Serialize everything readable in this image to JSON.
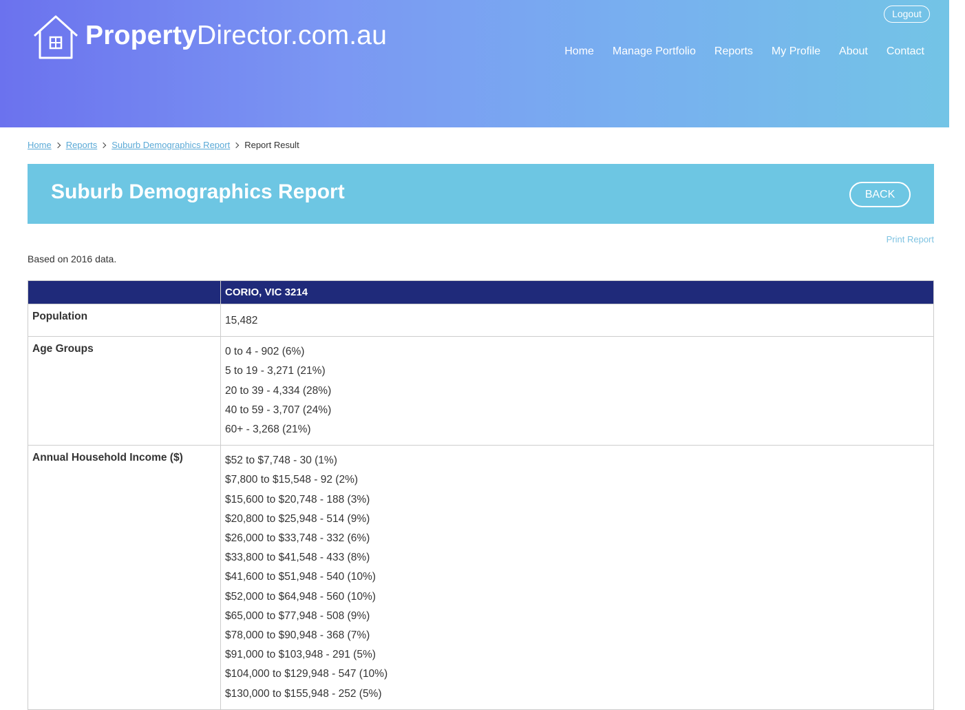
{
  "header": {
    "logo": {
      "bold": "Property",
      "light": "Director.com.au"
    },
    "logout_label": "Logout",
    "nav": [
      "Home",
      "Manage Portfolio",
      "Reports",
      "My Profile",
      "About",
      "Contact"
    ]
  },
  "breadcrumb": {
    "items": [
      "Home",
      "Reports",
      "Suburb Demographics Report"
    ],
    "current": "Report Result"
  },
  "banner": {
    "title": "Suburb Demographics Report",
    "back_label": "BACK"
  },
  "print_label": "Print Report",
  "based_on": "Based on 2016 data.",
  "table": {
    "header_col1": "",
    "header_col2": "CORIO, VIC 3214",
    "rows": [
      {
        "label": "Population",
        "values": [
          "15,482"
        ]
      },
      {
        "label": "Age Groups",
        "values": [
          "0 to 4 - 902 (6%)",
          "5 to 19 - 3,271 (21%)",
          "20 to 39 - 4,334 (28%)",
          "40 to 59 - 3,707 (24%)",
          "60+ - 3,268 (21%)"
        ]
      },
      {
        "label": "Annual Household Income ($)",
        "values": [
          "$52 to $7,748 - 30 (1%)",
          "$7,800 to $15,548 - 92 (2%)",
          "$15,600 to $20,748 - 188 (3%)",
          "$20,800 to $25,948 - 514 (9%)",
          "$26,000 to $33,748 - 332 (6%)",
          "$33,800 to $41,548 - 433 (8%)",
          "$41,600 to $51,948 - 540 (10%)",
          "$52,000 to $64,948 - 560 (10%)",
          "$65,000 to $77,948 - 508 (9%)",
          "$78,000 to $90,948 - 368 (7%)",
          "$91,000 to $103,948 - 291 (5%)",
          "$104,000 to $129,948 - 547 (10%)",
          "$130,000 to $155,948 - 252 (5%)"
        ]
      }
    ]
  },
  "colors": {
    "header_gradient_start": "#6b72ee",
    "header_gradient_end": "#73c4e6",
    "banner": "#6dc6e3",
    "table_header": "#1f2a7a",
    "link": "#5aa9d6"
  },
  "icons": {
    "logo": "house-icon",
    "breadcrumb_separator": "chevron-right-icon"
  }
}
